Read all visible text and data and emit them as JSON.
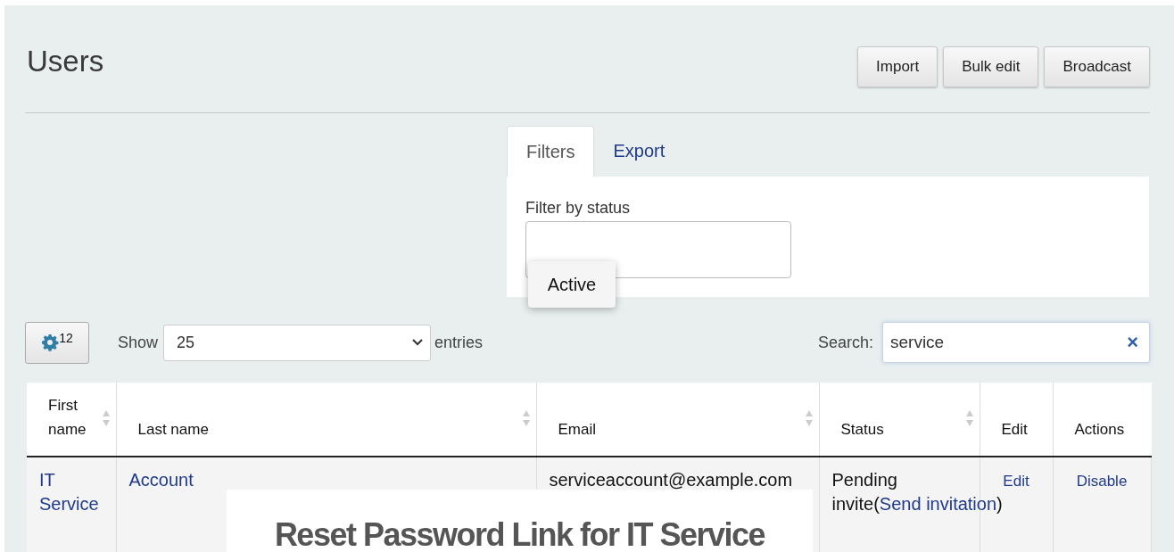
{
  "page": {
    "title": "Users"
  },
  "header_buttons": [
    "Import",
    "Bulk edit",
    "Broadcast"
  ],
  "tabs": [
    {
      "label": "Filters",
      "selected": true
    },
    {
      "label": "Export",
      "selected": false
    }
  ],
  "filter": {
    "label": "Filter by status",
    "tooltip": "Active"
  },
  "column_settings": {
    "count": "12"
  },
  "length": {
    "label_before": "Show",
    "value": "25",
    "label_after": "entries"
  },
  "search": {
    "label": "Search:",
    "value": "service",
    "clear": "×"
  },
  "table": {
    "columns": [
      {
        "label": "First name",
        "sortable": true
      },
      {
        "label": "Last name",
        "sortable": true
      },
      {
        "label": "Email",
        "sortable": true
      },
      {
        "label": "Status",
        "sortable": true
      },
      {
        "label": "Edit",
        "sortable": false
      },
      {
        "label": "Actions",
        "sortable": false
      }
    ],
    "rows": [
      {
        "first_name": "IT Service",
        "last_name": "Account",
        "email": "serviceaccount@example.com",
        "status": {
          "text": "Pending invite(",
          "link": "Send invitation",
          "after": ")"
        },
        "edit": "Edit",
        "action": "Disable"
      }
    ]
  },
  "dialog": {
    "title": "Reset Password Link for IT Service"
  }
}
